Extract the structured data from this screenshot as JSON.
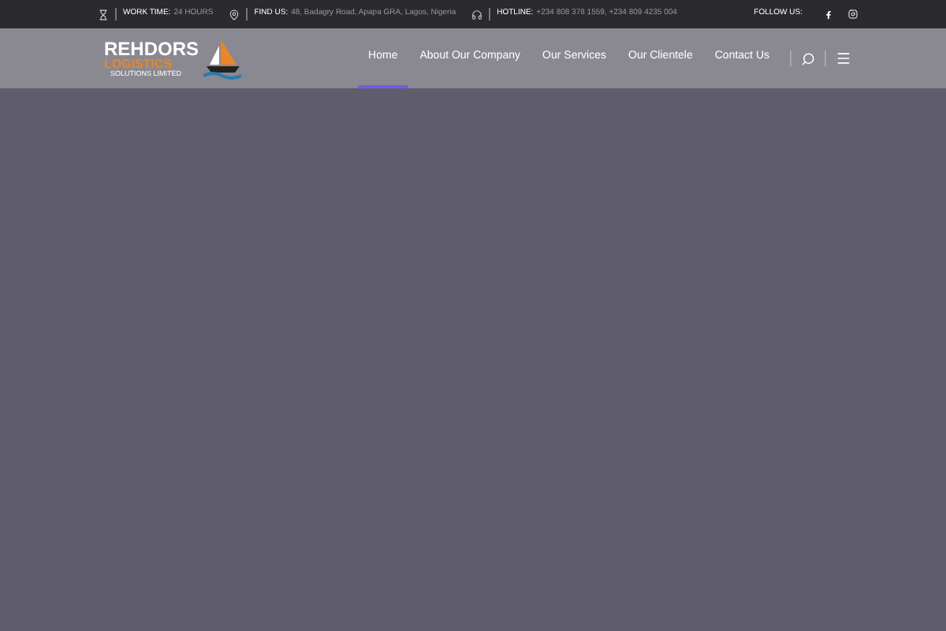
{
  "top_bar": {
    "items": [
      {
        "kind": "hourglass",
        "label": "WORK TIME:",
        "value": "24 HOURS"
      },
      {
        "kind": "pin",
        "label": "FIND US:",
        "value": "48, Badagry Road, Apapa GRA, Lagos, Nigeria"
      },
      {
        "kind": "headset",
        "label": "HOTLINE:",
        "value": "+234 808 378 1559, +234 809 4235 004"
      }
    ],
    "follow_label": "FOLLOW US:"
  },
  "logo": {
    "line_1": "REHDORS",
    "line_2": "LOGISTICS",
    "line_3": "SOLUTIONS LIMITED"
  },
  "nav": [
    {
      "label": "Home",
      "selected": true
    },
    {
      "label": "About Our Company",
      "selected": false
    },
    {
      "label": "Our Services",
      "selected": false
    },
    {
      "label": "Our Clientele",
      "selected": false
    },
    {
      "label": "Contact Us",
      "selected": false
    }
  ]
}
